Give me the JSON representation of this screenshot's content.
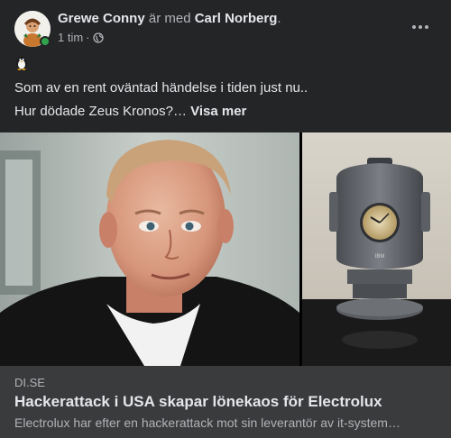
{
  "post": {
    "author": "Grewe Conny",
    "with_text": " är med ",
    "tagged": "Carl Norberg",
    "tagged_suffix": ".",
    "time": "1 tim",
    "separator": " · ",
    "audience_icon": "globe-icon",
    "more_icon": "more-options-icon",
    "emoji_icon": "penguin-icon",
    "text_line_1": "Som av en rent oväntad händelse i tiden just nu..",
    "text_line_2": "Hur dödade Zeus Kronos?…",
    "see_more": "Visa mer"
  },
  "link_preview": {
    "domain": "DI.SE",
    "title": "Hackerattack i USA skapar lönekaos för Electrolux",
    "description": "Electrolux har efter en hackerattack mot sin leverantör av it-system…",
    "image_left": "portrait-photo",
    "image_right": "ibm-clock-photo",
    "clock_brand": "IBM"
  },
  "colors": {
    "background": "#242526",
    "preview_background": "#3a3b3c",
    "primary_text": "#e4e6eb",
    "secondary_text": "#b0b3b8",
    "online": "#31a24c"
  }
}
